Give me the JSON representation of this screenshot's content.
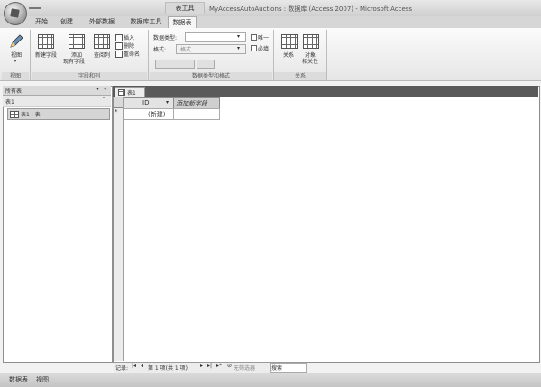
{
  "window": {
    "title": "MyAccessAutoAuctions : 数据库 (Access 2007) - Microsoft Access"
  },
  "context_tab_header": "表工具",
  "tabs": [
    {
      "label": "开始",
      "active": false
    },
    {
      "label": "创建",
      "active": false
    },
    {
      "label": "外部数据",
      "active": false
    },
    {
      "label": "数据库工具",
      "active": false
    },
    {
      "label": "数据表",
      "active": true
    }
  ],
  "ribbon": {
    "view_group": {
      "label": "视图",
      "buttons": {
        "view": "视图"
      }
    },
    "fields_group": {
      "label": "字段和列",
      "buttons": {
        "new_field": "新建字段",
        "add_existing": "添加",
        "add_existing_2": "现有字段",
        "lookup_column": "查阅列",
        "insert": "插入",
        "delete": "删除",
        "rename": "重命名"
      }
    },
    "format_group": {
      "label": "数据类型和格式",
      "data_type_label": "数据类型:",
      "format_label": "格式:",
      "format_value": "格式",
      "unique_label": "唯一",
      "required_label": "必填"
    },
    "relationships_group": {
      "label": "关系",
      "buttons": {
        "relationships": "关系",
        "dependencies_1": "对象",
        "dependencies_2": "相关性"
      }
    }
  },
  "nav_pane": {
    "header": "所有表",
    "group": "表1",
    "items": [
      {
        "label": "表1 : 表"
      }
    ]
  },
  "document": {
    "tab_label": "表1",
    "columns": [
      "ID",
      "添加新字段"
    ],
    "new_row_label": "(新建)",
    "new_row_marker": "*"
  },
  "record_nav": {
    "label": "记录:",
    "position": "第 1 项(共 1 项)",
    "filter": "无筛选器",
    "search": "搜索"
  },
  "status_bar": {
    "left": "数据表",
    "view": "视图"
  }
}
